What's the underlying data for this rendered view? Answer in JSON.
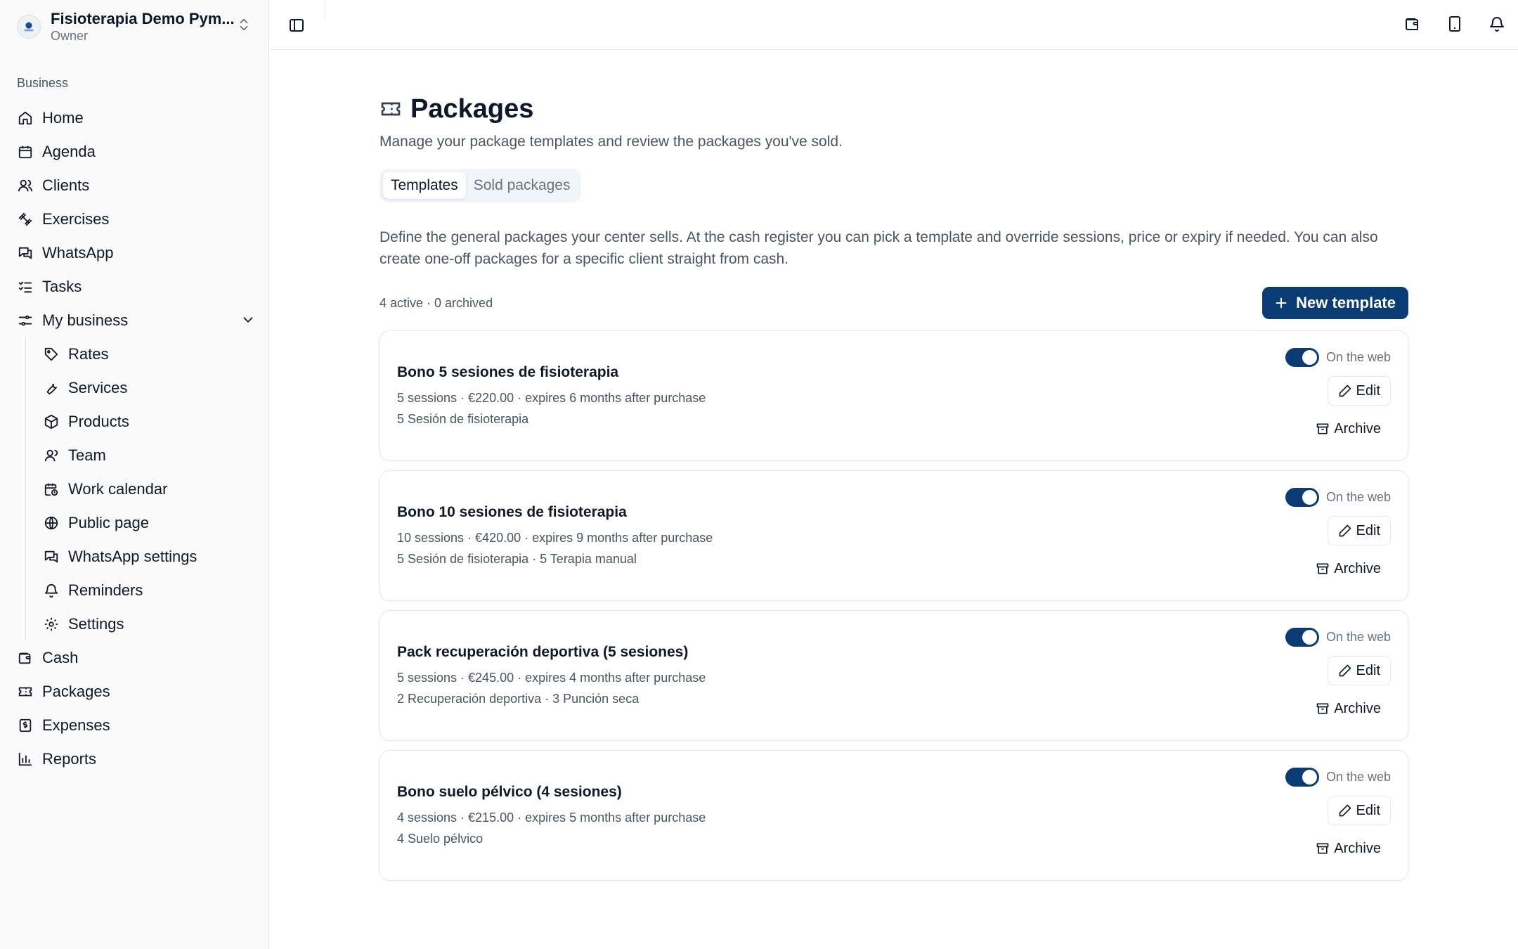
{
  "org": {
    "name": "Fisioterapia Demo Pym...",
    "role": "Owner"
  },
  "sidebar": {
    "section_label": "Business",
    "items": [
      {
        "label": "Home",
        "icon": "home-icon"
      },
      {
        "label": "Agenda",
        "icon": "calendar-icon"
      },
      {
        "label": "Clients",
        "icon": "users-icon"
      },
      {
        "label": "Exercises",
        "icon": "dumbbell-icon"
      },
      {
        "label": "WhatsApp",
        "icon": "chat-icon"
      },
      {
        "label": "Tasks",
        "icon": "list-checks-icon"
      },
      {
        "label": "My business",
        "icon": "sliders-icon"
      }
    ],
    "sub_items": [
      {
        "label": "Rates",
        "icon": "tag-icon"
      },
      {
        "label": "Services",
        "icon": "wrench-icon"
      },
      {
        "label": "Products",
        "icon": "box-icon"
      },
      {
        "label": "Team",
        "icon": "user-icon"
      },
      {
        "label": "Work calendar",
        "icon": "calendar-clock-icon"
      },
      {
        "label": "Public page",
        "icon": "globe-icon"
      },
      {
        "label": "WhatsApp settings",
        "icon": "chat-icon"
      },
      {
        "label": "Reminders",
        "icon": "bell-icon"
      },
      {
        "label": "Settings",
        "icon": "gear-icon"
      }
    ],
    "bottom_items": [
      {
        "label": "Cash",
        "icon": "wallet-icon"
      },
      {
        "label": "Packages",
        "icon": "ticket-icon"
      },
      {
        "label": "Expenses",
        "icon": "receipt-icon"
      },
      {
        "label": "Reports",
        "icon": "bar-chart-icon"
      }
    ]
  },
  "page": {
    "title": "Packages",
    "subtitle": "Manage your package templates and review the packages you've sold.",
    "tabs": [
      {
        "label": "Templates",
        "active": true
      },
      {
        "label": "Sold packages",
        "active": false
      }
    ],
    "description": "Define the general packages your center sells. At the cash register you can pick a template and override sessions, price or expiry if needed. You can also create one-off packages for a specific client straight from cash.",
    "count": "4 active · 0 archived",
    "new_button": "New template"
  },
  "card_labels": {
    "web": "On the web",
    "edit": "Edit",
    "archive": "Archive"
  },
  "templates": [
    {
      "name": "Bono 5 sesiones de fisioterapia",
      "meta": "5 sessions · €220.00 · expires 6 months after purchase",
      "services": "5 Sesión de fisioterapia",
      "on_web": true
    },
    {
      "name": "Bono 10 sesiones de fisioterapia",
      "meta": "10 sessions · €420.00 · expires 9 months after purchase",
      "services": "5 Sesión de fisioterapia · 5 Terapia manual",
      "on_web": true
    },
    {
      "name": "Pack recuperación deportiva (5 sesiones)",
      "meta": "5 sessions · €245.00 · expires 4 months after purchase",
      "services": "2 Recuperación deportiva · 3 Punción seca",
      "on_web": true
    },
    {
      "name": "Bono suelo pélvico (4 sesiones)",
      "meta": "4 sessions · €215.00 · expires 5 months after purchase",
      "services": "4 Suelo pélvico",
      "on_web": true
    }
  ],
  "colors": {
    "primary": "#0b3b73",
    "border": "#e5e7eb",
    "muted": "#4b5563"
  }
}
